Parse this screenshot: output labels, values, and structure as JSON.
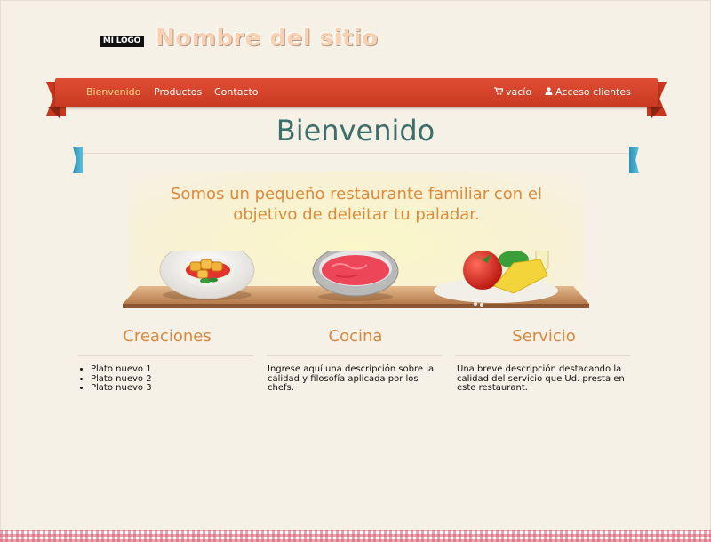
{
  "header": {
    "logo_text": "MI LOGO",
    "site_name": "Nombre del sitio"
  },
  "nav": {
    "items": [
      {
        "label": "Bienvenido",
        "active": true
      },
      {
        "label": "Productos",
        "active": false
      },
      {
        "label": "Contacto",
        "active": false
      }
    ],
    "cart": {
      "icon": "cart-icon",
      "label": "vacío"
    },
    "account": {
      "icon": "user-icon",
      "label": "Acceso clientes"
    }
  },
  "main": {
    "title": "Bienvenido",
    "hero_text": "Somos un pequeño restaurante familiar con el objetivo de deleitar tu paladar."
  },
  "columns": [
    {
      "title": "Creaciones",
      "items": [
        "Plato nuevo 1",
        "Plato nuevo 2",
        "Plato nuevo 3"
      ]
    },
    {
      "title": "Cocina",
      "text": "Ingrese aquí una descripción sobre la calidad y filosofía aplicada por los chefs."
    },
    {
      "title": "Servicio",
      "text": "Una breve descripción destacando la calidad del servicio que Ud. presta en este restaurant."
    }
  ],
  "colors": {
    "background": "#f6f1e7",
    "nav_red": "#d8432a",
    "active_nav": "#ffd98a",
    "heading_teal": "#3d6f6b",
    "accent_orange": "#d9883d"
  }
}
